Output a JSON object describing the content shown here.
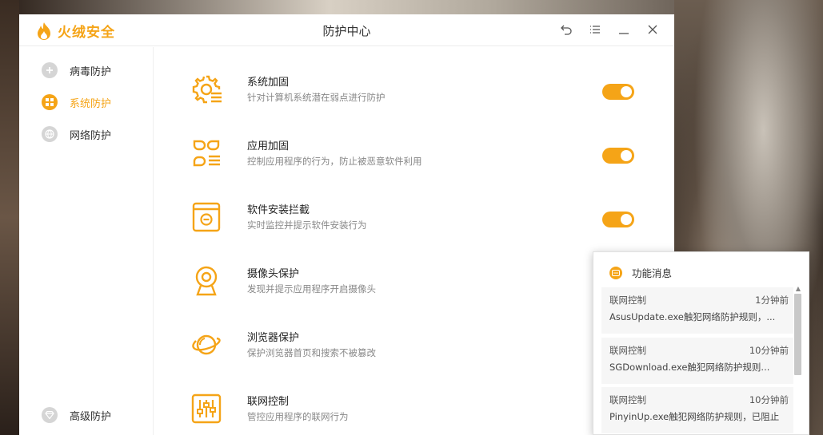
{
  "app": {
    "name": "火绒安全",
    "window_title": "防护中心",
    "brand_color": "#f5a417"
  },
  "window_controls": [
    {
      "icon": "back-icon"
    },
    {
      "icon": "menu-icon"
    },
    {
      "icon": "minimize-icon"
    },
    {
      "icon": "close-icon"
    }
  ],
  "sidebar": {
    "items": [
      {
        "label": "病毒防护",
        "icon": "plus-circle-icon",
        "active": false
      },
      {
        "label": "系统防护",
        "icon": "windows-icon",
        "active": true
      },
      {
        "label": "网络防护",
        "icon": "globe-icon",
        "active": false
      },
      {
        "label": "高级防护",
        "icon": "diamond-icon",
        "active": false
      }
    ]
  },
  "features": [
    {
      "title": "系统加固",
      "desc": "针对计算机系统潜在弱点进行防护",
      "icon": "gear-shield-icon",
      "enabled": true
    },
    {
      "title": "应用加固",
      "desc": "控制应用程序的行为，防止被恶意软件利用",
      "icon": "apps-icon",
      "enabled": true
    },
    {
      "title": "软件安装拦截",
      "desc": "实时监控并提示软件安装行为",
      "icon": "install-block-icon",
      "enabled": true
    },
    {
      "title": "摄像头保护",
      "desc": "发现并提示应用程序开启摄像头",
      "icon": "camera-icon"
    },
    {
      "title": "浏览器保护",
      "desc": "保护浏览器首页和搜索不被篡改",
      "icon": "planet-icon"
    },
    {
      "title": "联网控制",
      "desc": "管控应用程序的联网行为",
      "icon": "sliders-icon"
    }
  ],
  "notification": {
    "title": "功能消息",
    "messages": [
      {
        "head": "联网控制",
        "time": "1分钟前",
        "body": "AsusUpdate.exe触犯网络防护规则，..."
      },
      {
        "head": "联网控制",
        "time": "10分钟前",
        "body": "SGDownload.exe触犯网络防护规则..."
      },
      {
        "head": "联网控制",
        "time": "10分钟前",
        "body": "PinyinUp.exe触犯网络防护规则，已阻止"
      }
    ]
  }
}
